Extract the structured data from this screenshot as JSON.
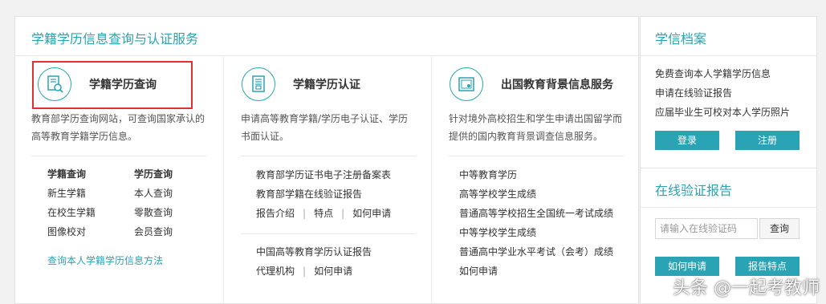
{
  "main": {
    "title": "学籍学历信息查询与认证服务",
    "col1": {
      "title": "学籍学历查询",
      "desc1": "教育部学历查询网站，可查询国家承认的",
      "desc2": "高等教育学籍学历信息。",
      "grid": [
        [
          "学籍查询",
          "学历查询"
        ],
        [
          "新生学籍",
          "本人查询"
        ],
        [
          "在校生学籍",
          "零散查询"
        ],
        [
          "图像校对",
          "会员查询"
        ]
      ],
      "method_link": "查询本人学籍学历信息方法"
    },
    "col2": {
      "title": "学籍学历认证",
      "desc1": "申请高等教育学籍/学历电子认证、学历",
      "desc2": "书面认证。",
      "item1": "教育部学历证书电子注册备案表",
      "item2": "教育部学籍在线验证报告",
      "meta1": [
        "报告介绍",
        "特点",
        "如何申请"
      ],
      "item3": "中国高等教育学历认证报告",
      "meta2": [
        "代理机构",
        "如何申请"
      ]
    },
    "col3": {
      "title": "出国教育背景信息服务",
      "desc1": "针对境外高校招生和学生申请出国留学而",
      "desc2": "提供的国内教育背景调查信息服务。",
      "items": [
        "中等教育学历",
        "高等学校学生成绩",
        "普通高等学校招生全国统一考试成绩",
        "中等学校学生成绩",
        "普通高中学业水平考试（会考）成绩",
        "如何申请"
      ]
    }
  },
  "side_top": {
    "title": "学信档案",
    "items": [
      "免费查询本人学籍学历信息",
      "申请在线验证报告",
      "应届毕业生可校对本人学历照片"
    ],
    "login": "登录",
    "register": "注册"
  },
  "side_bot": {
    "title": "在线验证报告",
    "placeholder": "请输入在线验证码",
    "query": "查询",
    "how": "如何申请",
    "features": "报告特点"
  },
  "watermark": "头条 @一起考教师",
  "colors": {
    "accent": "#2aa4b4",
    "highlight": "#e03030"
  }
}
